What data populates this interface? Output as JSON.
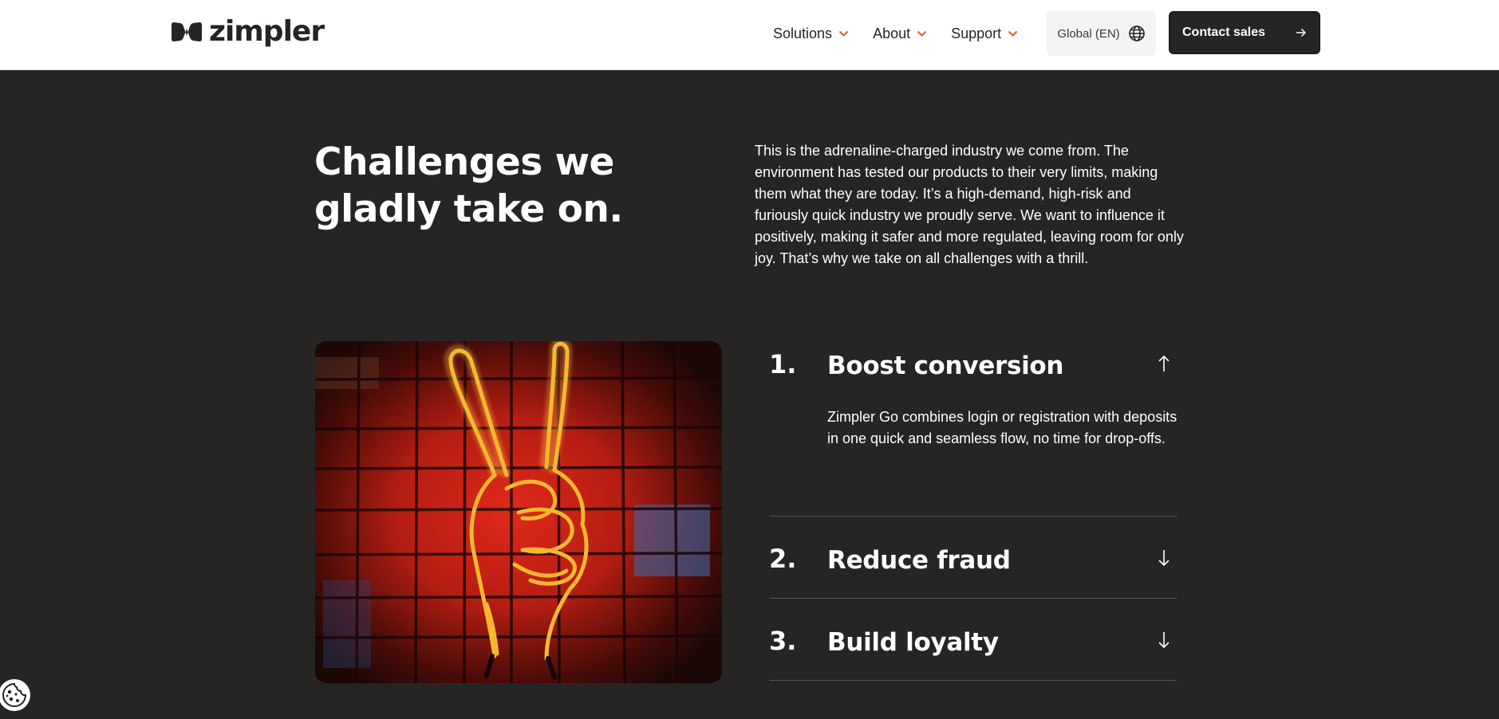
{
  "header": {
    "brand": "zimpler",
    "nav": [
      {
        "label": "Solutions"
      },
      {
        "label": "About"
      },
      {
        "label": "Support"
      }
    ],
    "locale_label": "Global (EN)",
    "contact_label": "Contact sales"
  },
  "intro": {
    "headline": "Challenges we gladly take on.",
    "text": "This is the adrenaline-charged industry we come from. The environment has tested our products to their very limits, making them what they are today. It’s a high-demand, high-risk and furiously quick industry we proudly serve. We want to influence it positively, making it safer and more regulated, leaving room for only joy. That’s why we take on all challenges with a thrill."
  },
  "accordion": [
    {
      "number": "1.",
      "title": "Boost conversion",
      "expanded": true,
      "body": "Zimpler Go combines login or registration with deposits in one quick and seamless flow, no time for drop-offs."
    },
    {
      "number": "2.",
      "title": "Reduce fraud",
      "expanded": false
    },
    {
      "number": "3.",
      "title": "Build loyalty",
      "expanded": false
    }
  ],
  "colors": {
    "accent": "#e4572e",
    "background": "#262524",
    "text": "#ffffff"
  }
}
